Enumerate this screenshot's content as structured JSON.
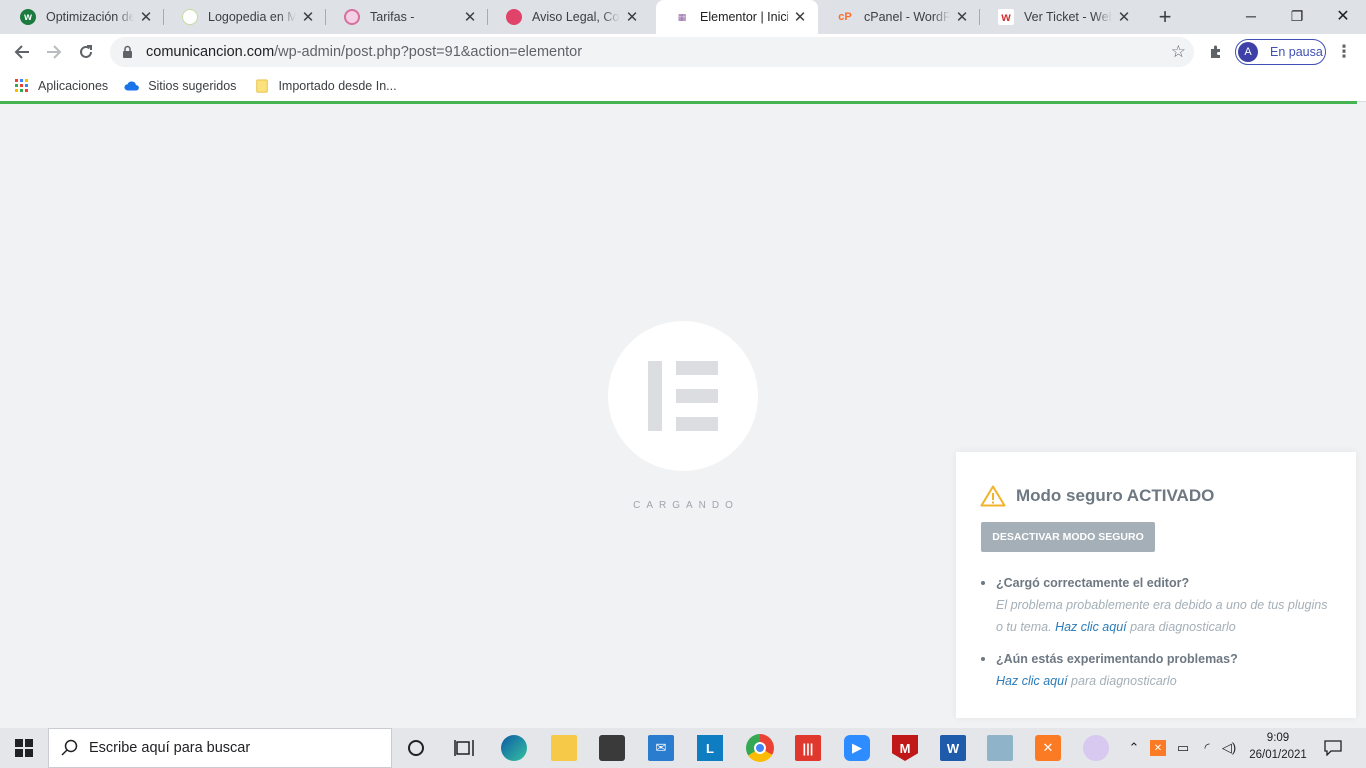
{
  "tabs": [
    {
      "title": "Optimización de n",
      "favicon_color": "#1b7a3e",
      "favicon_letter": "w"
    },
    {
      "title": "Logopedia en Mad",
      "favicon_color": "#c5dca0",
      "favicon_letter": ""
    },
    {
      "title": "Tarifas -",
      "favicon_color": "#d66fa0",
      "favicon_letter": ""
    },
    {
      "title": "Aviso Legal, Cooki",
      "favicon_color": "#e0426a",
      "favicon_letter": ""
    },
    {
      "title": "Elementor | Inicio",
      "favicon_color": "#8e5fa0",
      "favicon_letter": ""
    },
    {
      "title": "cPanel - WordPres",
      "favicon_color": "#ff6c2c",
      "favicon_letter": "cP"
    },
    {
      "title": "Ver Ticket - Weber",
      "favicon_color": "#ffffff",
      "favicon_letter": "w"
    }
  ],
  "active_tab_index": 4,
  "address": {
    "host": "comunicancion.com",
    "path": "/wp-admin/post.php?post=91&action=elementor"
  },
  "profile": {
    "initial": "A",
    "label": "En pausa"
  },
  "bookmarks": [
    {
      "label": "Aplicaciones",
      "icon": "apps-grid-icon"
    },
    {
      "label": "Sitios sugeridos",
      "icon": "cloud-icon"
    },
    {
      "label": "Importado desde In...",
      "icon": "folder-icon"
    }
  ],
  "page": {
    "loading_text": "CARGANDO"
  },
  "safe_mode": {
    "title": "Modo seguro ACTIVADO",
    "button": "DESACTIVAR MODO SEGURO",
    "items": [
      {
        "question": "¿Cargó correctamente el editor?",
        "answer_pre": "El problema probablemente era debido a uno de tus plugins o tu tema. ",
        "link": "Haz clic aquí",
        "answer_post": " para diagnosticarlo"
      },
      {
        "question": "¿Aún estás experimentando problemas?",
        "answer_pre": "",
        "link": "Haz clic aquí",
        "answer_post": " para diagnosticarlo"
      }
    ]
  },
  "taskbar": {
    "search_placeholder": "Escribe aquí para buscar",
    "time": "9:09",
    "date": "26/01/2021"
  },
  "colors": {
    "progress": "#46b450",
    "link": "#2b7bb9",
    "panel_text": "#6d7882"
  }
}
